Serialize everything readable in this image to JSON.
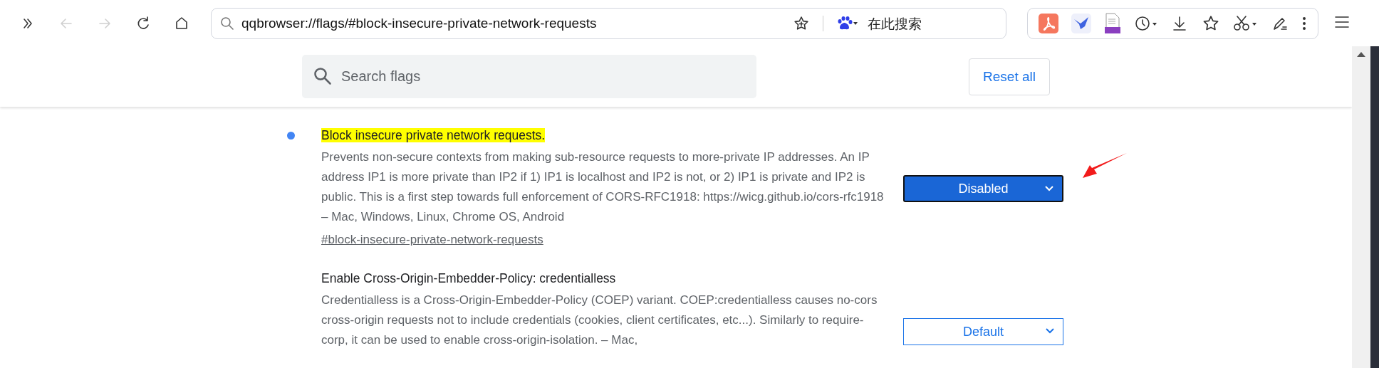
{
  "toolbar": {
    "nav_buttons": [
      {
        "kind": "overflow",
        "disabled": false
      },
      {
        "kind": "back",
        "disabled": true
      },
      {
        "kind": "forward",
        "disabled": true
      },
      {
        "kind": "reload",
        "disabled": false
      },
      {
        "kind": "home",
        "disabled": false
      }
    ],
    "address": "qqbrowser://flags/#block-insecure-private-network-requests",
    "search_box": {
      "placeholder": "在此搜索"
    }
  },
  "search": {
    "placeholder": "Search flags"
  },
  "reset_button": "Reset all",
  "flags": [
    {
      "title": "Block insecure private network requests.",
      "modified": true,
      "highlighted": true,
      "description": "Prevents non-secure contexts from making sub-resource requests to more-private IP addresses. An IP address IP1 is more private than IP2 if 1) IP1 is localhost and IP2 is not, or 2) IP1 is private and IP2 is public. This is a first step towards full enforcement of CORS-RFC1918: https://wicg.github.io/cors-rfc1918 – Mac, Windows, Linux, Chrome OS, Android",
      "link": "#block-insecure-private-network-requests",
      "select": {
        "value": "Disabled",
        "focused": true
      }
    },
    {
      "title": "Enable Cross-Origin-Embedder-Policy: credentialless",
      "modified": false,
      "highlighted": false,
      "description": "Credentialless is a Cross-Origin-Embedder-Policy (COEP) variant. COEP:credentialless causes no-cors cross-origin requests not to include credentials (cookies, client certificates, etc...). Similarly to require-corp, it can be used to enable cross-origin-isolation. – Mac,",
      "select": {
        "value": "Default",
        "focused": false
      }
    }
  ]
}
